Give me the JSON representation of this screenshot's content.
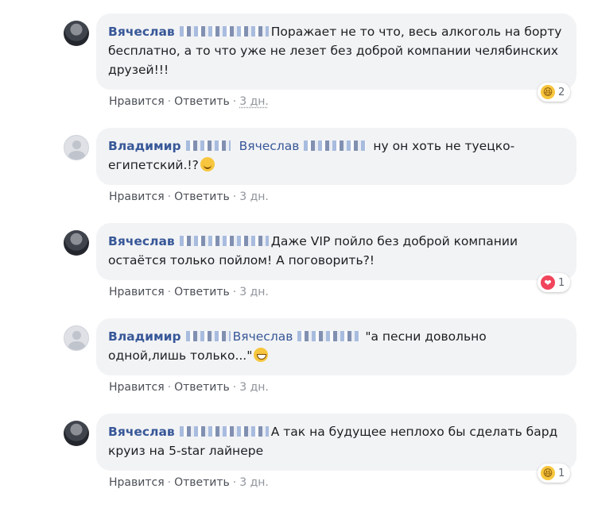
{
  "actions": {
    "like": "Нравится",
    "reply": "Ответить",
    "separator": "·"
  },
  "reaction_icons": {
    "haha": "😆",
    "love": "❤"
  },
  "comments": [
    {
      "author": "Вячеслав",
      "text": "Поражает не то что, весь алкоголь на борту бесплатно, а то что уже не лезет без доброй компании челябинских друзей!!!",
      "time": "3 дн.",
      "reaction": {
        "type": "haha",
        "count": "2"
      }
    },
    {
      "author": "Владимир",
      "mention": "Вячеслав",
      "text": "ну он хоть не туецко-египетский.!?",
      "emoji": "smirk-emoji",
      "time": "3 дн."
    },
    {
      "author": "Вячеслав",
      "text": "Даже VIP пойло без доброй компании остаётся только пойлом! А поговорить?!",
      "time": "3 дн.",
      "reaction": {
        "type": "love",
        "count": "1"
      }
    },
    {
      "author": "Владимир",
      "mention": "Вячеслав",
      "text": "\"а песни довольно одной,лишь только...\"",
      "emoji": "grin-emoji",
      "time": "3 дн."
    },
    {
      "author": "Вячеслав",
      "text": "А так на будущее неплохо бы сделать бард круиз на 5-star лайнере",
      "time": "3 дн.",
      "reaction": {
        "type": "haha",
        "count": "1"
      }
    }
  ]
}
